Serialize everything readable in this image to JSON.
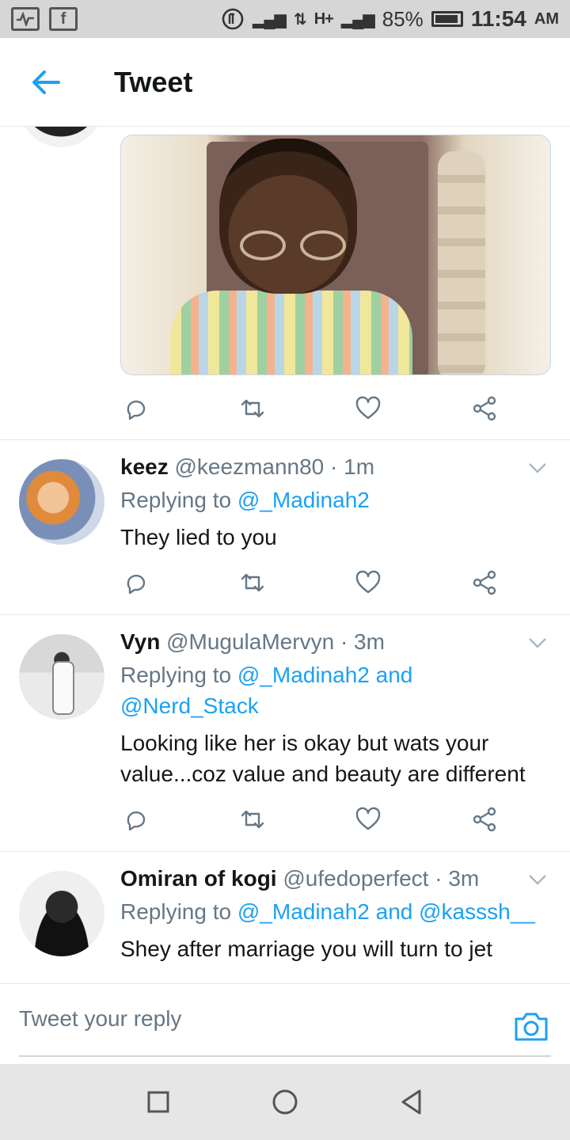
{
  "status_bar": {
    "battery": "85%",
    "time": "11:54",
    "ampm": "AM",
    "network_label": "H+"
  },
  "header": {
    "title": "Tweet"
  },
  "replies": [
    {
      "name": "keez",
      "handle": "@keezmann80",
      "time": "· 1m",
      "replying_prefix": "Replying to",
      "replying_to": "@_Madinah2",
      "text": "They lied to you"
    },
    {
      "name": "Vyn",
      "handle": "@MugulaMervyn",
      "time": "· 3m",
      "replying_prefix": "Replying to",
      "replying_to": "@_Madinah2 and @Nerd_Stack",
      "text": "Looking like her is okay but wats your value...coz value and beauty are different"
    },
    {
      "name": "Omiran of kogi",
      "handle": "@ufedoperfect",
      "time": "· 3m",
      "replying_prefix": "Replying to",
      "replying_to": "@_Madinah2 and @kasssh__",
      "text": "Shey after marriage you will turn to jet"
    }
  ],
  "composer": {
    "placeholder": "Tweet your reply"
  },
  "colors": {
    "accent": "#1da1f2",
    "text_secondary": "#657786",
    "divider": "#e1e8ed"
  },
  "icons": [
    "back-arrow-icon",
    "reply-icon",
    "retweet-icon",
    "like-icon",
    "share-icon",
    "chevron-down-icon",
    "camera-icon",
    "recent-apps-icon",
    "home-icon",
    "back-icon"
  ]
}
